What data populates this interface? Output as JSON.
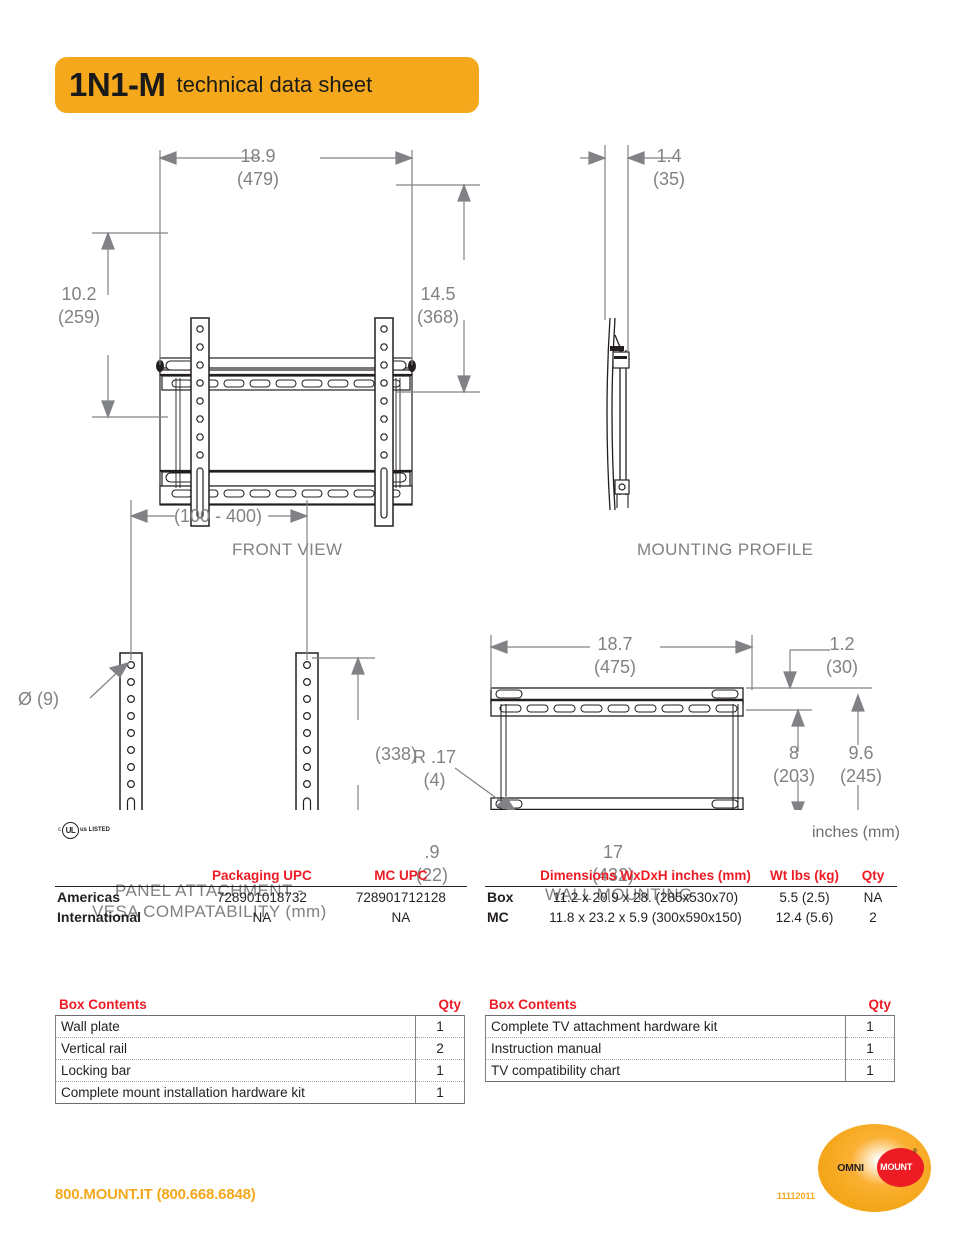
{
  "header": {
    "model": "1N1-M",
    "subtitle": "technical data sheet"
  },
  "views": {
    "front": {
      "label": "FRONT VIEW",
      "width_in": "18.9",
      "width_mm": "(479)",
      "height_left_in": "10.2",
      "height_left_mm": "(259)",
      "height_right_in": "14.5",
      "height_right_mm": "(368)"
    },
    "profile": {
      "label": "MOUNTING PROFILE",
      "depth_in": "1.4",
      "depth_mm": "(35)"
    },
    "panel": {
      "label_line1": "PANEL ATTACHMENT -",
      "label_line2": "VESA COMPATABILITY (mm)",
      "span_mm": "(100 - 400)",
      "hole_dia": "Ø (9)",
      "height_mm": "(338)"
    },
    "wall": {
      "label": "WALL MOUNTING",
      "width_in": "18.7",
      "width_mm": "(475)",
      "top_offset_in": "1.2",
      "top_offset_mm": "(30)",
      "inner_height_in": "8",
      "inner_height_mm": "(203)",
      "outer_height_in": "9.6",
      "outer_height_mm": "(245)",
      "radius_in": "R .17",
      "radius_mm": "(4)",
      "edge_in": ".9",
      "edge_mm": "(22)",
      "bottom_width_in": "17",
      "bottom_width_mm": "(432)"
    }
  },
  "ul_mark": {
    "prefix": "c",
    "circle": "UL",
    "suffix": "us LISTED"
  },
  "units_note": "inches (mm)",
  "upc_table": {
    "headers": [
      "",
      "Packaging UPC",
      "MC UPC"
    ],
    "rows": [
      {
        "region": "Americas",
        "packaging_upc": "728901018732",
        "mc_upc": "728901712128"
      },
      {
        "region": "International",
        "packaging_upc": "NA",
        "mc_upc": "NA"
      }
    ]
  },
  "dimensions_table": {
    "headers": [
      "",
      "Dimensions WxDxH inches (mm)",
      "Wt lbs (kg)",
      "Qty"
    ],
    "rows": [
      {
        "type": "Box",
        "dimensions": "11.2 x 20.9 x 28. (285x530x70)",
        "weight": "5.5 (2.5)",
        "qty": "NA"
      },
      {
        "type": "MC",
        "dimensions": "11.8 x 23.2 x 5.9 (300x590x150)",
        "weight": "12.4 (5.6)",
        "qty": "2"
      }
    ]
  },
  "contents_left": {
    "title": "Box Contents",
    "qty_label": "Qty",
    "rows": [
      {
        "item": "Wall plate",
        "qty": "1"
      },
      {
        "item": "Vertical rail",
        "qty": "2"
      },
      {
        "item": "Locking bar",
        "qty": "1"
      },
      {
        "item": "Complete mount installation hardware kit",
        "qty": "1"
      }
    ]
  },
  "contents_right": {
    "title": "Box Contents",
    "qty_label": "Qty",
    "rows": [
      {
        "item": "Complete TV attachment hardware kit",
        "qty": "1"
      },
      {
        "item": "Instruction manual",
        "qty": "1"
      },
      {
        "item": "TV compatibility chart",
        "qty": "1"
      }
    ]
  },
  "footer": {
    "phone": "800.MOUNT.IT (800.668.6848)",
    "doc_number": "11112011",
    "logo_omni": "OMNI",
    "logo_mount": "MOUNT",
    "logo_tm": "®"
  },
  "colors": {
    "brand_orange": "#F5A81C",
    "accent_red": "#ED1C24",
    "dim_gray": "#808285",
    "ink": "#231f20"
  }
}
